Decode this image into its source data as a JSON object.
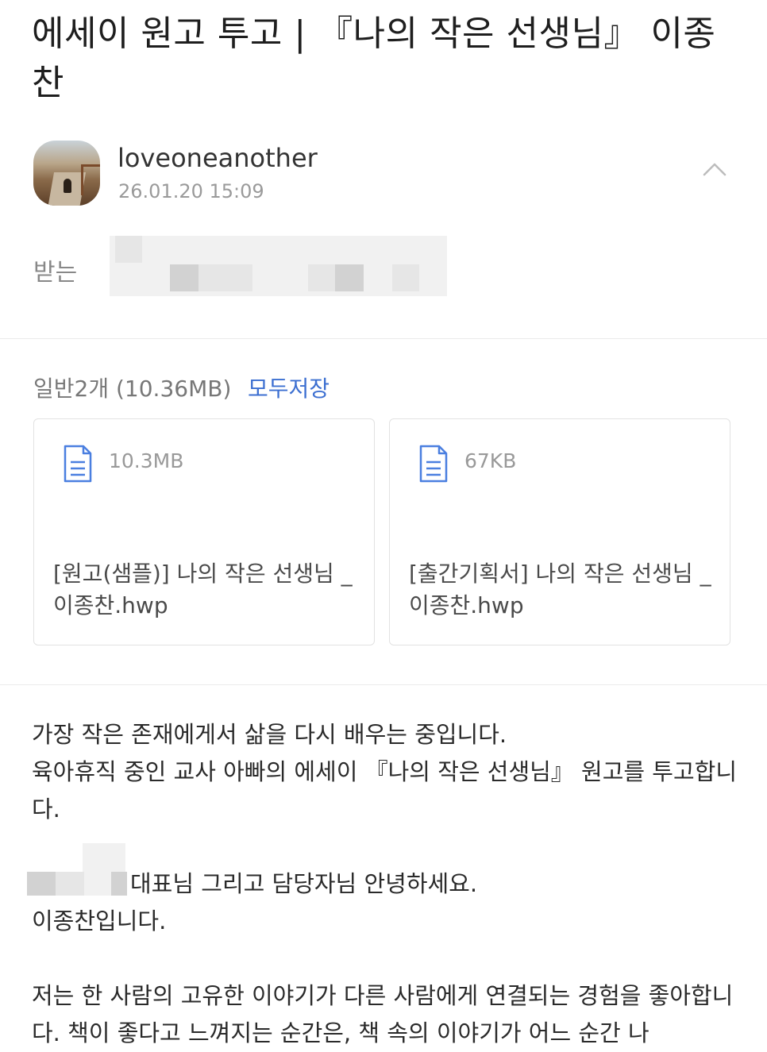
{
  "mail": {
    "subject": "에세이 원고 투고 | 『나의 작은 선생님』 이종찬",
    "sender": {
      "name": "loveoneanother",
      "datetime": "26.01.20 15:09"
    },
    "recipient_label": "받는",
    "attachments": {
      "summary": "일반2개 (10.36MB)",
      "save_all_label": "모두저장",
      "files": [
        {
          "size": "10.3MB",
          "name": "[원고(샘플)] 나의 작은 선생님 _ 이종찬.hwp"
        },
        {
          "size": "67KB",
          "name": "[출간기획서] 나의 작은 선생님 _ 이종찬.hwp"
        }
      ]
    },
    "body": {
      "intro_line1": "가장 작은 존재에게서 삶을 다시 배우는 중입니다.",
      "intro_line2": "육아휴직 중인 교사 아빠의 에세이 『나의 작은 선생님』 원고를 투고합니다.",
      "greeting_line1": "대표님 그리고 담당자님 안녕하세요.",
      "greeting_line2": "이종찬입니다.",
      "para1": "저는 한 사람의 고유한 이야기가 다른 사람에게 연결되는 경험을 좋아합니다. 책이 좋다고 느껴지는 순간은, 책 속의 이야기가 어느 순간 나"
    }
  },
  "colors": {
    "link": "#3c6fd1",
    "doc_icon": "#4a7fe0"
  },
  "icons": {
    "collapse": "chevron-up-icon",
    "attachment": "document-icon"
  }
}
